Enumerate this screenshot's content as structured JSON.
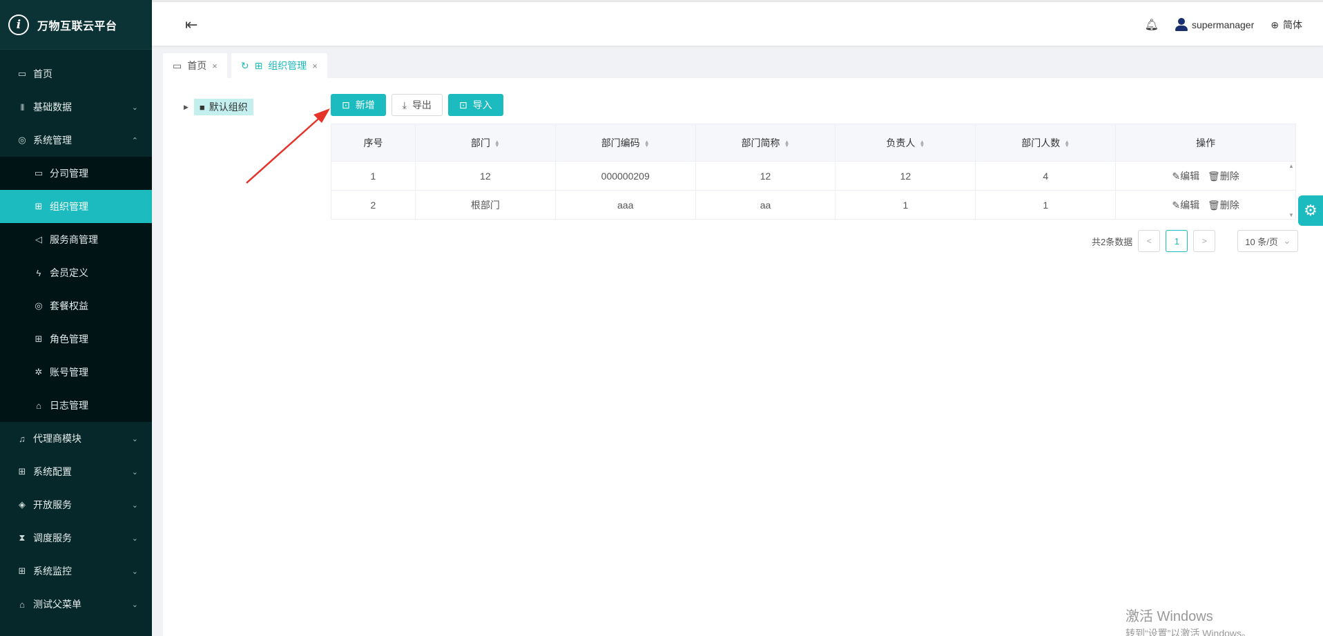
{
  "app": {
    "title": "万物互联云平台",
    "logo_glyph": "i"
  },
  "sidebar": {
    "items": [
      {
        "label": "首页",
        "icon": "calendar-icon",
        "glyph": "▭"
      },
      {
        "label": "基础数据",
        "icon": "barcode-icon",
        "glyph": "|||"
      },
      {
        "label": "系统管理",
        "icon": "camera-icon",
        "glyph": "◎"
      },
      {
        "label": "分司管理",
        "icon": "calendar-icon",
        "glyph": "▭"
      },
      {
        "label": "组织管理",
        "icon": "table-icon",
        "glyph": "⊞"
      },
      {
        "label": "服务商管理",
        "icon": "speaker-icon",
        "glyph": "◁"
      },
      {
        "label": "会员定义",
        "icon": "lightning-icon",
        "glyph": "ϟ"
      },
      {
        "label": "套餐权益",
        "icon": "camera-icon",
        "glyph": "◎"
      },
      {
        "label": "角色管理",
        "icon": "table-icon",
        "glyph": "⊞"
      },
      {
        "label": "账号管理",
        "icon": "bug-icon",
        "glyph": "✲"
      },
      {
        "label": "日志管理",
        "icon": "home-icon",
        "glyph": "⌂"
      },
      {
        "label": "代理商模块",
        "icon": "bell-icon",
        "glyph": "♫"
      },
      {
        "label": "系统配置",
        "icon": "table-icon",
        "glyph": "⊞"
      },
      {
        "label": "开放服务",
        "icon": "tag-icon",
        "glyph": "◈"
      },
      {
        "label": "调度服务",
        "icon": "hourglass-icon",
        "glyph": "⧗"
      },
      {
        "label": "系统监控",
        "icon": "table-icon",
        "glyph": "⊞"
      },
      {
        "label": "测试父菜单",
        "icon": "bank-icon",
        "glyph": "⌂"
      }
    ],
    "active_item": "组织管理"
  },
  "header": {
    "username": "supermanager",
    "language": "简体"
  },
  "tabs": [
    {
      "label": "首页"
    },
    {
      "label": "组织管理",
      "active": true
    }
  ],
  "tree": {
    "node_label": "默认组织"
  },
  "toolbar": {
    "add_label": "新增",
    "export_label": "导出",
    "import_label": "导入"
  },
  "table": {
    "columns": [
      "序号",
      "部门",
      "部门编码",
      "部门简称",
      "负责人",
      "部门人数",
      "操作"
    ],
    "rows": [
      {
        "index": "1",
        "dept": "12",
        "code": "000000209",
        "short": "12",
        "owner": "12",
        "count": "4"
      },
      {
        "index": "2",
        "dept": "根部门",
        "code": "aaa",
        "short": "aa",
        "owner": "1",
        "count": "1"
      }
    ],
    "edit_label": "编辑",
    "delete_label": "删除"
  },
  "pagination": {
    "total_text": "共2条数据",
    "current_page": "1",
    "page_size": "10 条/页"
  },
  "watermark": {
    "line1": "激活 Windows",
    "line2": "转到“设置”以激活 Windows。"
  },
  "colors": {
    "accent": "#1bbbbf",
    "sidebar_bg": "#07282a",
    "submenu_bg": "#001315",
    "annotation_arrow": "#e5332a"
  }
}
